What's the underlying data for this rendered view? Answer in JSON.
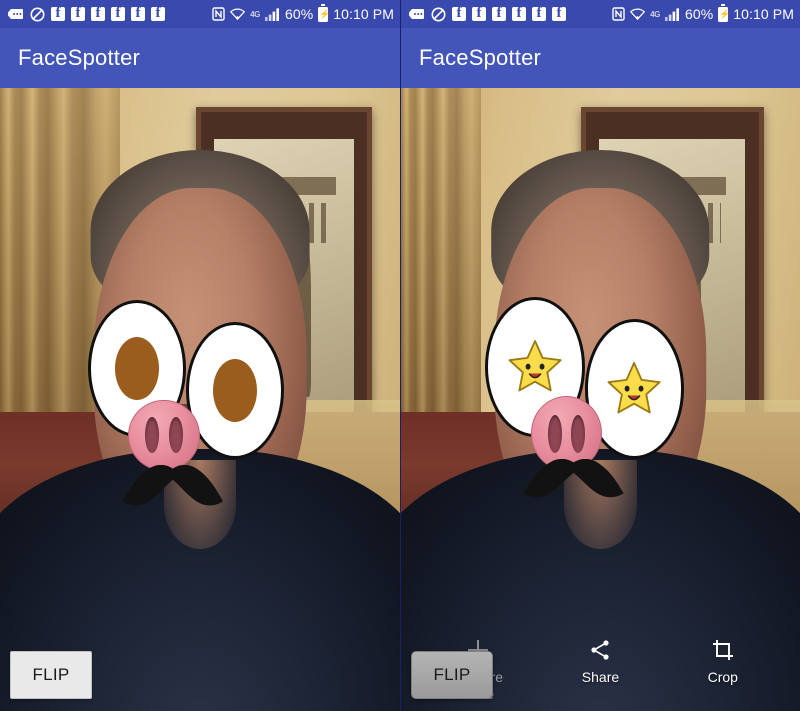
{
  "statusbar": {
    "icons": [
      "message-icon",
      "do-not-disturb-icon",
      "facebook-icon",
      "facebook-icon",
      "facebook-icon",
      "facebook-icon",
      "facebook-icon",
      "facebook-icon"
    ],
    "facebook_count": 6,
    "facebook_glyph": "f",
    "nfc_label": "N",
    "network_label": "4G",
    "battery_percent": "60%",
    "time": "10:10 PM",
    "background_color": "#3a49ad"
  },
  "appbar": {
    "title": "FaceSpotter",
    "background_color": "#4355b8",
    "text_color": "#ffffff"
  },
  "left_panel": {
    "name": "camera-preview-panel",
    "flip_label": "FLIP",
    "mask": {
      "eye_style": "plain-brown-pupil",
      "pupil_color": "#9b5d1e",
      "nose_style": "pig-snout",
      "nose_color": "#e98f9f",
      "mustache_color": "#121212",
      "expression": "neutral"
    }
  },
  "right_panel": {
    "name": "capture-preview-panel",
    "flip_label": "FLIP",
    "mask": {
      "eye_style": "star-pupil",
      "star_color": "#fbdc4a",
      "nose_style": "pig-snout",
      "nose_color": "#e98f9f",
      "mustache_color": "#121212",
      "expression": "smiling"
    },
    "actions": [
      {
        "id": "capture-more",
        "label": "Capture\nmore",
        "label_line1": "Capture",
        "label_line2": "more",
        "icon": "plus-icon",
        "enabled": false
      },
      {
        "id": "share",
        "label": "Share",
        "icon": "share-icon",
        "enabled": true
      },
      {
        "id": "crop",
        "label": "Crop",
        "icon": "crop-icon",
        "enabled": true
      }
    ]
  }
}
